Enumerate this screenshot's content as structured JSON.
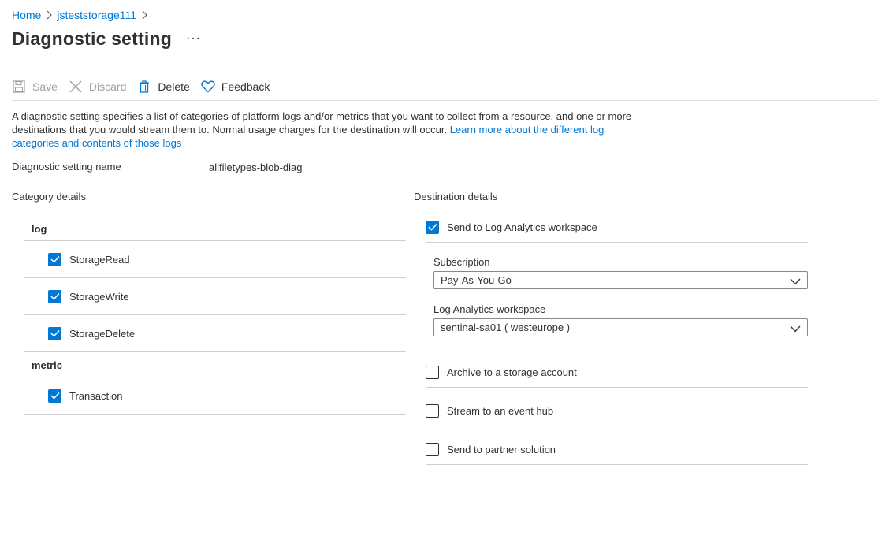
{
  "breadcrumb": {
    "items": [
      "Home",
      "jsteststorage111"
    ]
  },
  "page": {
    "title": "Diagnostic setting",
    "more": "···"
  },
  "toolbar": {
    "save": "Save",
    "discard": "Discard",
    "delete": "Delete",
    "feedback": "Feedback"
  },
  "description": {
    "text": "A diagnostic setting specifies a list of categories of platform logs and/or metrics that you want to collect from a resource, and one or more destinations that you would stream them to. Normal usage charges for the destination will occur. ",
    "link": "Learn more about the different log categories and contents of those logs"
  },
  "setting_name": {
    "label": "Diagnostic setting name",
    "value": "allfiletypes-blob-diag"
  },
  "category": {
    "heading": "Category details",
    "log_heading": "log",
    "logs": [
      {
        "label": "StorageRead",
        "checked": true
      },
      {
        "label": "StorageWrite",
        "checked": true
      },
      {
        "label": "StorageDelete",
        "checked": true
      }
    ],
    "metric_heading": "metric",
    "metrics": [
      {
        "label": "Transaction",
        "checked": true
      }
    ]
  },
  "destination": {
    "heading": "Destination details",
    "log_analytics": {
      "label": "Send to Log Analytics workspace",
      "checked": true
    },
    "subscription": {
      "label": "Subscription",
      "value": "Pay-As-You-Go"
    },
    "workspace": {
      "label": "Log Analytics workspace",
      "value": "sentinal-sa01 ( westeurope )"
    },
    "archive": {
      "label": "Archive to a storage account",
      "checked": false
    },
    "event_hub": {
      "label": "Stream to an event hub",
      "checked": false
    },
    "partner": {
      "label": "Send to partner solution",
      "checked": false
    }
  },
  "colors": {
    "accent": "#0078d4",
    "text": "#323130",
    "disabled": "#a19f9d",
    "divider": "#d2d0ce"
  }
}
